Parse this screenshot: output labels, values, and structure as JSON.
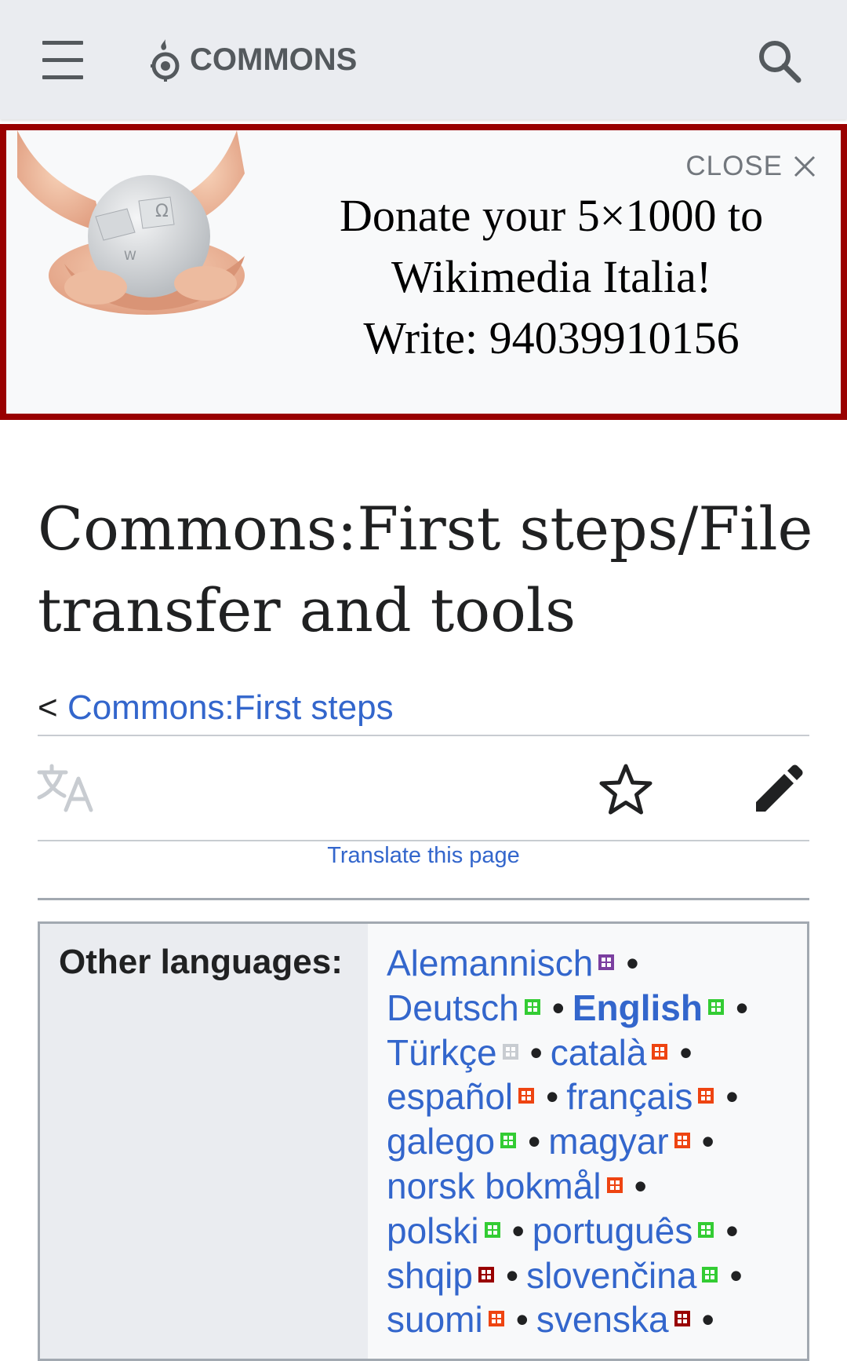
{
  "header": {
    "logo_text": "COMMONS",
    "menu_icon": "hamburger-menu-icon",
    "search_icon": "search-icon",
    "logo_icon": "commons-logo-icon"
  },
  "banner": {
    "close_label": "CLOSE",
    "lines": [
      "Donate your 5×1000 to",
      "Wikimedia Italia!",
      "Write: 94039910156"
    ],
    "border_color": "#990000"
  },
  "page": {
    "title": "Commons:First steps/File transfer and tools",
    "breadcrumb_prefix": "<",
    "breadcrumb_link": "Commons:First steps",
    "translate_link": "Translate this page"
  },
  "languages": {
    "label": "Other languages:",
    "lines": [
      [
        {
          "name": "Alemannisch",
          "badge": "#7b3fa0",
          "sep": true
        }
      ],
      [
        {
          "name": "Deutsch",
          "badge": "#33cc33",
          "sep": true
        },
        {
          "name": "English",
          "badge": "#33cc33",
          "sep": true,
          "current": true
        }
      ],
      [
        {
          "name": "Türkçe",
          "badge": "#c8ccd1",
          "sep": true
        },
        {
          "name": "català",
          "badge": "#ee4411",
          "sep": true
        }
      ],
      [
        {
          "name": "español",
          "badge": "#ee4411",
          "sep": true
        },
        {
          "name": "français",
          "badge": "#ee4411",
          "sep": true
        }
      ],
      [
        {
          "name": "galego",
          "badge": "#33cc33",
          "sep": true
        },
        {
          "name": "magyar",
          "badge": "#ee4411",
          "sep": true
        }
      ],
      [
        {
          "name": "norsk bokmål",
          "badge": "#ee4411",
          "sep": true
        }
      ],
      [
        {
          "name": "polski",
          "badge": "#33cc33",
          "sep": true
        },
        {
          "name": "português",
          "badge": "#33cc33",
          "sep": true
        }
      ],
      [
        {
          "name": "shqip",
          "badge": "#990000",
          "sep": true
        },
        {
          "name": "slovenčina",
          "badge": "#33cc33",
          "sep": true
        }
      ],
      [
        {
          "name": "suomi",
          "badge": "#ee4411",
          "sep": true
        },
        {
          "name": "svenska",
          "badge": "#990000",
          "sep": true
        }
      ]
    ]
  },
  "colors": {
    "link": "#3366cc",
    "header_bg": "#eaecf0",
    "text": "#202122"
  }
}
